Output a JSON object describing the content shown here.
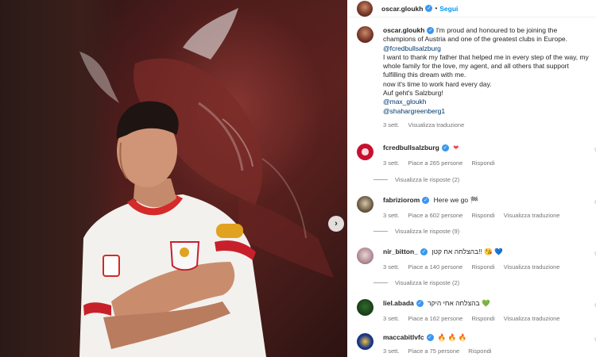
{
  "post": {
    "author": "oscar.gloukh",
    "follow_label": "Segui",
    "caption_lines": [
      "I'm proud and honoured to be joining the champions of Austria and one of the greatest clubs in Europe.",
      "@fcredbullsalzburg",
      "I want to thank my father that helped me in every step of the way, my whole family for the love, my agent, and all others that support fulfilling this dream with me.",
      "now it's time to work hard every day.",
      "Auf geht's Salzburg!",
      "@max_gloukh",
      "@shahargreenberg1"
    ],
    "caption_time": "3 sett.",
    "translate_label": "Visualizza traduzione"
  },
  "comments": [
    {
      "user": "fcredbullsalzburg",
      "text": "",
      "emoji": "❤",
      "time": "3 sett.",
      "likes": "Piace a 265 persone",
      "reply": "Rispondi",
      "translate": "",
      "replies": "Visualizza le risposte (2)"
    },
    {
      "user": "fabriziorom",
      "text": "Here we go",
      "emoji": "🏁",
      "time": "3 sett.",
      "likes": "Piace a 602 persone",
      "reply": "Rispondi",
      "translate": "Visualizza traduzione",
      "replies": "Visualizza le risposte (9)"
    },
    {
      "user": "nir_bitton_",
      "text": "בהצלחה אח קטן!!",
      "emoji": "😘 💙",
      "time": "3 sett.",
      "likes": "Piace a 140 persone",
      "reply": "Rispondi",
      "translate": "Visualizza traduzione",
      "replies": "Visualizza le risposte (2)"
    },
    {
      "user": "liel.abada",
      "text": "בהצלחה אחי היקר",
      "emoji": "💚",
      "time": "3 sett.",
      "likes": "Piace a 162 persone",
      "reply": "Rispondi",
      "translate": "Visualizza traduzione",
      "replies": ""
    },
    {
      "user": "maccabitlvfc",
      "text": "",
      "emoji": "🔥 🔥 🔥",
      "time": "3 sett.",
      "likes": "Piace a 75 persone",
      "reply": "Rispondi",
      "translate": "",
      "replies": ""
    }
  ],
  "icons": {
    "next": "chevron-right-icon",
    "verified": "verified-badge-icon",
    "like": "heart-outline-icon"
  },
  "colors": {
    "link_blue": "#0095f6",
    "mention": "#00376b",
    "muted": "#737373",
    "verified": "#3897f0"
  }
}
